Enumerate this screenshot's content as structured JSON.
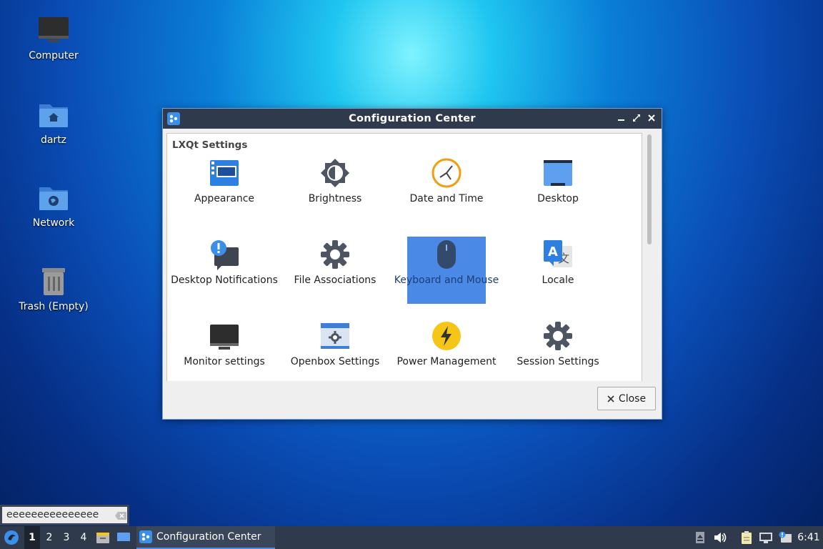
{
  "desktop": {
    "icons": [
      {
        "label": "Computer"
      },
      {
        "label": "dartz"
      },
      {
        "label": "Network"
      },
      {
        "label": "Trash (Empty)"
      }
    ]
  },
  "window": {
    "title": "Configuration Center",
    "section_title": "LXQt Settings",
    "items": [
      {
        "label": "Appearance",
        "icon": "appearance-icon"
      },
      {
        "label": "Brightness",
        "icon": "brightness-icon"
      },
      {
        "label": "Date and Time",
        "icon": "clock-icon"
      },
      {
        "label": "Desktop",
        "icon": "desktop-icon"
      },
      {
        "label": "Desktop Notifications",
        "icon": "notification-icon"
      },
      {
        "label": "File Associations",
        "icon": "gear-icon"
      },
      {
        "label": "Keyboard and Mouse",
        "icon": "mouse-icon",
        "selected": true
      },
      {
        "label": "Locale",
        "icon": "locale-icon"
      },
      {
        "label": "Monitor settings",
        "icon": "monitor-icon"
      },
      {
        "label": "Openbox Settings",
        "icon": "openbox-icon"
      },
      {
        "label": "Power Management",
        "icon": "power-icon"
      },
      {
        "label": "Session Settings",
        "icon": "gear-icon"
      }
    ],
    "close_label": "Close"
  },
  "search": {
    "value": "eeeeeeeeeeeeeee"
  },
  "taskbar": {
    "workspaces": [
      "1",
      "2",
      "3",
      "4"
    ],
    "active_workspace": "1",
    "task_label": "Configuration Center",
    "clock": "6:41"
  },
  "colors": {
    "selection": "#4a8ae6",
    "titlebar": "#2f3a4c",
    "accent_yellow": "#f5c518",
    "accent_orange": "#f39c12"
  }
}
